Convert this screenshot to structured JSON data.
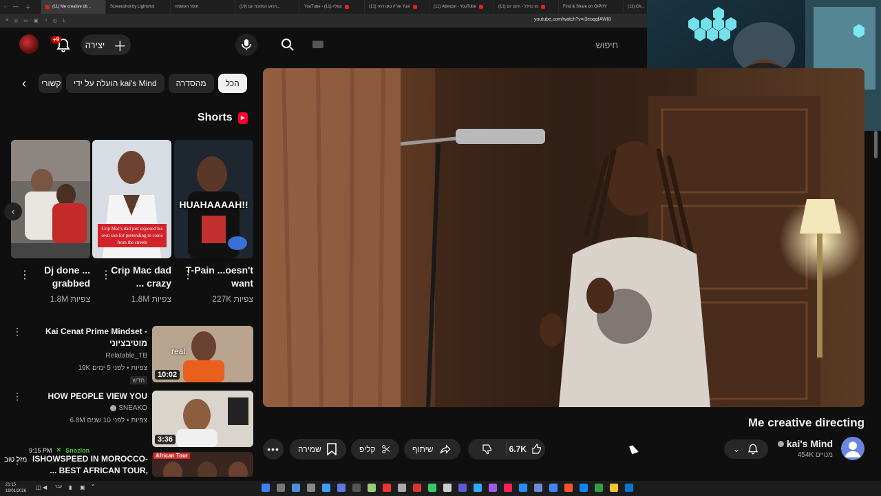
{
  "browser": {
    "tabs": [
      {
        "title": "(11) Me creative dir..."
      },
      {
        "title": "Screenshot by Lightshot"
      },
      {
        "title": "חוסר הגושמה"
      },
      {
        "title": "(19) הרגע המזוכה עם..."
      },
      {
        "title": "YouTube - קפליו (11)"
      },
      {
        "title": "(11) טקו וירגי // Ve Yuvi"
      },
      {
        "title": "(11) #denzel - YouTube"
      },
      {
        "title": "(11) נזו כהלל - היום יום"
      },
      {
        "title": "Find & Share on GIPHY"
      },
      {
        "title": "(11) Ch..."
      }
    ],
    "url": "youtube.com/watch?v=i3eoqqfAWI8"
  },
  "header": {
    "notif_badge": "+9",
    "create_label": "יצירה",
    "search_placeholder": "חיפוש"
  },
  "chips": [
    {
      "label": "הכל",
      "active": true
    },
    {
      "label": "מהסדרה"
    },
    {
      "label": "הועלה על ידי kai's Mind"
    },
    {
      "label": "קשורי"
    }
  ],
  "shorts": {
    "title": "Shorts",
    "items": [
      {
        "title": "T-Pain ...oesn't want",
        "views": "227K צפיות",
        "overlay": "HUAHAAAAH!!"
      },
      {
        "title": "Crip Mac dad ... crazy",
        "views": "1.8M צפיות",
        "overlay": "Crip Mac's dad just exposed his own son for pretending to come from the streets"
      },
      {
        "title": "Dj done ... grabbed",
        "views": "1.8M צפיות",
        "overlay": ""
      }
    ]
  },
  "related": [
    {
      "title": "Kai Cenat Prime Mindset - מוטיבציוני",
      "channel": "Relatable_TB",
      "meta": "19K צפיות • לפני 5 ימים",
      "badge": "חדש",
      "duration": "10:02",
      "thumb_text": "real."
    },
    {
      "title": "HOW PEOPLE VIEW YOU",
      "channel": "SNEAKO",
      "meta": "6.8M צפיות • לפני 10 שנים",
      "duration": "3:36"
    },
    {
      "title": "ISHOWSPEED IN MOROCCO- ... BEST AFRICAN TOUR,",
      "thumb_text": "African Tour"
    }
  ],
  "chat": {
    "time": "9:15 PM",
    "name": "Snozlon",
    "msg": "מזל טוב"
  },
  "video": {
    "title": "Me creative directing",
    "channel": "kai's Mind",
    "subscribers": "454K מנויים",
    "likes": "6.7K",
    "share_label": "שיתוף",
    "clip_label": "קליפ",
    "save_label": "שמירה"
  },
  "taskbar": {
    "time": "21:15",
    "date": "19/01/2026",
    "lang": "עבר"
  },
  "colors": {
    "background": "#0f0f0f",
    "chip": "#272727",
    "accent": "#ff0033",
    "chat_name": "#4ec83a"
  }
}
